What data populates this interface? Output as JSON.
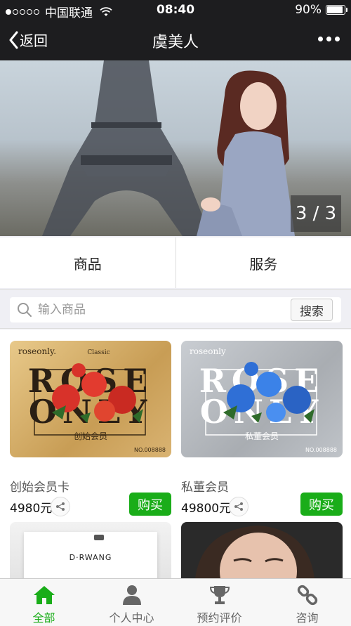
{
  "status_bar": {
    "carrier": "中国联通",
    "time": "08:40",
    "battery": "90%",
    "battery_level": 0.9
  },
  "nav": {
    "back_label": "返回",
    "title": "虞美人"
  },
  "banner": {
    "counter": "3 / 3"
  },
  "tabs": [
    {
      "label": "商品"
    },
    {
      "label": "服务"
    }
  ],
  "search": {
    "placeholder": "输入商品",
    "button_label": "搜索"
  },
  "products": [
    {
      "name": "创始会员卡",
      "price": "4980元",
      "buy_label": "购买",
      "card_brand": "roseonly.",
      "card_tag": "Classic",
      "card_word_1": "ROSE",
      "card_word_2": "ONLY",
      "card_member": "创始会员",
      "card_no": "NO.008888"
    },
    {
      "name": "私董会员",
      "price": "49800元",
      "buy_label": "购买",
      "card_brand": "roseonly",
      "card_tag": "",
      "card_word_1": "ROSE",
      "card_word_2": "ONLY",
      "card_member": "私董会员",
      "card_no": "NO.008888"
    },
    {
      "card_brand": "D·RWANG"
    },
    {}
  ],
  "tabbar": [
    {
      "label": "全部",
      "icon": "home-icon",
      "active": true
    },
    {
      "label": "个人中心",
      "icon": "user-icon",
      "active": false
    },
    {
      "label": "预约评价",
      "icon": "trophy-icon",
      "active": false
    },
    {
      "label": "咨询",
      "icon": "link-icon",
      "active": false
    }
  ],
  "colors": {
    "accent": "#1aad19",
    "header": "#1d1d1f"
  }
}
